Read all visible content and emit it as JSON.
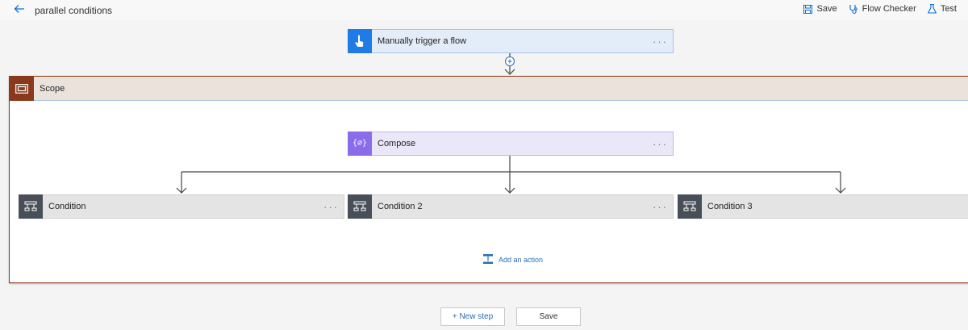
{
  "header": {
    "title": "parallel conditions",
    "actions": [
      {
        "label": "Save",
        "icon": "save-icon"
      },
      {
        "label": "Flow Checker",
        "icon": "stethoscope-icon"
      },
      {
        "label": "Test",
        "icon": "flask-icon"
      }
    ]
  },
  "trigger": {
    "label": "Manually trigger a flow",
    "icon": "touch-icon",
    "color": "#1f7be6"
  },
  "scope": {
    "title": "Scope",
    "icon": "scope-icon",
    "color": "#8a3a1c",
    "compose": {
      "label": "Compose",
      "icon": "compose-icon",
      "glyph": "{⌀}",
      "color": "#8a6cea"
    },
    "conditions": [
      {
        "label": "Condition"
      },
      {
        "label": "Condition 2"
      },
      {
        "label": "Condition 3"
      }
    ],
    "add_action": "Add an action"
  },
  "footer": {
    "new_step": "+ New step",
    "save": "Save"
  },
  "more_glyph": "···"
}
